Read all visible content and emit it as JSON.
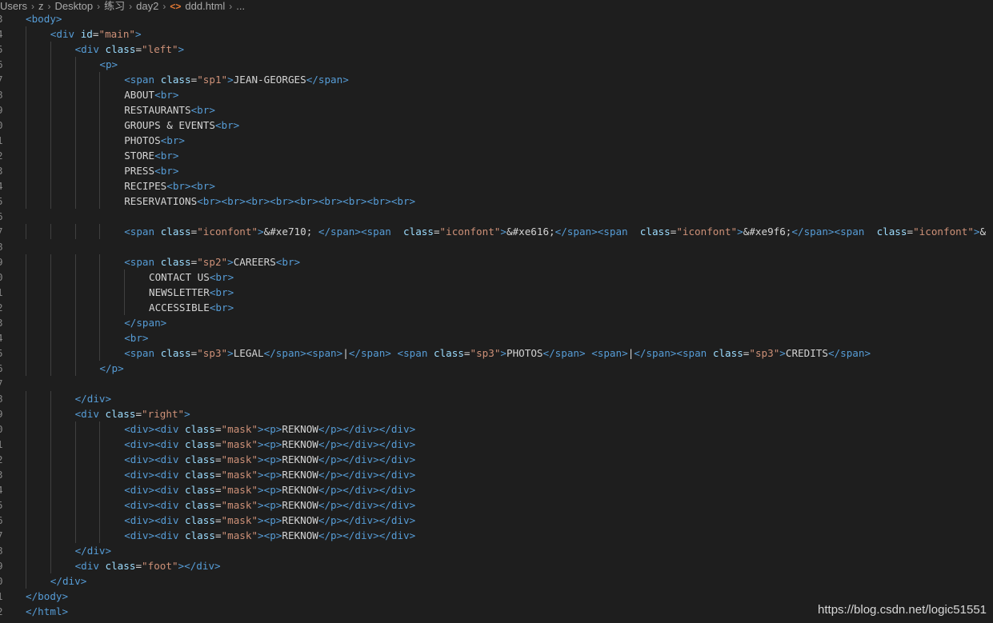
{
  "breadcrumb": {
    "parts": [
      "Users",
      "z",
      "Desktop",
      "练习",
      "day2",
      "ddd.html",
      "..."
    ],
    "file_icon": "<>"
  },
  "lines": [
    {
      "n": "3",
      "indent": 0,
      "tokens": [
        [
          "tag",
          "<body>"
        ]
      ]
    },
    {
      "n": "4",
      "indent": 1,
      "tokens": [
        [
          "tag",
          "<div "
        ],
        [
          "attr",
          "id"
        ],
        [
          "txt",
          "="
        ],
        [
          "str",
          "\"main\""
        ],
        [
          "tag",
          ">"
        ]
      ]
    },
    {
      "n": "5",
      "indent": 2,
      "tokens": [
        [
          "tag",
          "<div "
        ],
        [
          "attr",
          "class"
        ],
        [
          "txt",
          "="
        ],
        [
          "str",
          "\"left\""
        ],
        [
          "tag",
          ">"
        ]
      ]
    },
    {
      "n": "6",
      "indent": 3,
      "tokens": [
        [
          "tag",
          "<p>"
        ]
      ]
    },
    {
      "n": "7",
      "indent": 4,
      "tokens": [
        [
          "tag",
          "<span "
        ],
        [
          "attr",
          "class"
        ],
        [
          "txt",
          "="
        ],
        [
          "str",
          "\"sp1\""
        ],
        [
          "tag",
          ">"
        ],
        [
          "txt",
          "JEAN-GEORGES"
        ],
        [
          "tag",
          "</span>"
        ]
      ]
    },
    {
      "n": "8",
      "indent": 4,
      "tokens": [
        [
          "txt",
          "ABOUT"
        ],
        [
          "tag",
          "<br>"
        ]
      ]
    },
    {
      "n": "9",
      "indent": 4,
      "tokens": [
        [
          "txt",
          "RESTAURANTS"
        ],
        [
          "tag",
          "<br>"
        ]
      ]
    },
    {
      "n": "0",
      "indent": 4,
      "tokens": [
        [
          "txt",
          "GROUPS & EVENTS"
        ],
        [
          "tag",
          "<br>"
        ]
      ]
    },
    {
      "n": "1",
      "indent": 4,
      "tokens": [
        [
          "txt",
          "PHOTOS"
        ],
        [
          "tag",
          "<br>"
        ]
      ]
    },
    {
      "n": "2",
      "indent": 4,
      "tokens": [
        [
          "txt",
          "STORE"
        ],
        [
          "tag",
          "<br>"
        ]
      ]
    },
    {
      "n": "3",
      "indent": 4,
      "tokens": [
        [
          "txt",
          "PRESS"
        ],
        [
          "tag",
          "<br>"
        ]
      ]
    },
    {
      "n": "4",
      "indent": 4,
      "tokens": [
        [
          "txt",
          "RECIPES"
        ],
        [
          "tag",
          "<br><br>"
        ]
      ]
    },
    {
      "n": "5",
      "indent": 4,
      "tokens": [
        [
          "txt",
          "RESERVATIONS"
        ],
        [
          "tag",
          "<br><br><br><br><br><br><br><br><br>"
        ]
      ]
    },
    {
      "n": "6",
      "indent": 0,
      "tokens": []
    },
    {
      "n": "7",
      "indent": 4,
      "tokens": [
        [
          "tag",
          "<span "
        ],
        [
          "attr",
          "class"
        ],
        [
          "txt",
          "="
        ],
        [
          "str",
          "\"iconfont\""
        ],
        [
          "tag",
          ">"
        ],
        [
          "ent",
          "&#xe710; "
        ],
        [
          "tag",
          "</span><span  "
        ],
        [
          "attr",
          "class"
        ],
        [
          "txt",
          "="
        ],
        [
          "str",
          "\"iconfont\""
        ],
        [
          "tag",
          ">"
        ],
        [
          "ent",
          "&#xe616;"
        ],
        [
          "tag",
          "</span><span  "
        ],
        [
          "attr",
          "class"
        ],
        [
          "txt",
          "="
        ],
        [
          "str",
          "\"iconfont\""
        ],
        [
          "tag",
          ">"
        ],
        [
          "ent",
          "&#xe9f6;"
        ],
        [
          "tag",
          "</span><span  "
        ],
        [
          "attr",
          "class"
        ],
        [
          "txt",
          "="
        ],
        [
          "str",
          "\"iconfont\""
        ],
        [
          "tag",
          ">"
        ],
        [
          "ent",
          "&"
        ]
      ]
    },
    {
      "n": "8",
      "indent": 0,
      "tokens": []
    },
    {
      "n": "9",
      "indent": 4,
      "tokens": [
        [
          "tag",
          "<span "
        ],
        [
          "attr",
          "class"
        ],
        [
          "txt",
          "="
        ],
        [
          "str",
          "\"sp2\""
        ],
        [
          "tag",
          ">"
        ],
        [
          "txt",
          "CAREERS"
        ],
        [
          "tag",
          "<br>"
        ]
      ]
    },
    {
      "n": "0",
      "indent": 5,
      "tokens": [
        [
          "txt",
          "CONTACT US"
        ],
        [
          "tag",
          "<br>"
        ]
      ]
    },
    {
      "n": "1",
      "indent": 5,
      "tokens": [
        [
          "txt",
          "NEWSLETTER"
        ],
        [
          "tag",
          "<br>"
        ]
      ]
    },
    {
      "n": "2",
      "indent": 5,
      "tokens": [
        [
          "txt",
          "ACCESSIBLE"
        ],
        [
          "tag",
          "<br>"
        ]
      ]
    },
    {
      "n": "3",
      "indent": 4,
      "tokens": [
        [
          "tag",
          "</span>"
        ]
      ]
    },
    {
      "n": "4",
      "indent": 4,
      "tokens": [
        [
          "tag",
          "<br>"
        ]
      ]
    },
    {
      "n": "5",
      "indent": 4,
      "tokens": [
        [
          "tag",
          "<span "
        ],
        [
          "attr",
          "class"
        ],
        [
          "txt",
          "="
        ],
        [
          "str",
          "\"sp3\""
        ],
        [
          "tag",
          ">"
        ],
        [
          "txt",
          "LEGAL"
        ],
        [
          "tag",
          "</span><span>"
        ],
        [
          "txt",
          "|"
        ],
        [
          "tag",
          "</span>"
        ],
        [
          "txt",
          " "
        ],
        [
          "tag",
          "<span "
        ],
        [
          "attr",
          "class"
        ],
        [
          "txt",
          "="
        ],
        [
          "str",
          "\"sp3\""
        ],
        [
          "tag",
          ">"
        ],
        [
          "txt",
          "PHOTOS"
        ],
        [
          "tag",
          "</span>"
        ],
        [
          "txt",
          " "
        ],
        [
          "tag",
          "<span>"
        ],
        [
          "txt",
          "|"
        ],
        [
          "tag",
          "</span><span "
        ],
        [
          "attr",
          "class"
        ],
        [
          "txt",
          "="
        ],
        [
          "str",
          "\"sp3\""
        ],
        [
          "tag",
          ">"
        ],
        [
          "txt",
          "CREDITS"
        ],
        [
          "tag",
          "</span>"
        ]
      ]
    },
    {
      "n": "6",
      "indent": 3,
      "tokens": [
        [
          "tag",
          "</p>"
        ]
      ]
    },
    {
      "n": "7",
      "indent": 0,
      "tokens": []
    },
    {
      "n": "8",
      "indent": 2,
      "tokens": [
        [
          "tag",
          "</div>"
        ]
      ]
    },
    {
      "n": "9",
      "indent": 2,
      "tokens": [
        [
          "tag",
          "<div "
        ],
        [
          "attr",
          "class"
        ],
        [
          "txt",
          "="
        ],
        [
          "str",
          "\"right\""
        ],
        [
          "tag",
          ">"
        ]
      ]
    },
    {
      "n": "0",
      "indent": 4,
      "tokens": [
        [
          "tag",
          "<div><div "
        ],
        [
          "attr",
          "class"
        ],
        [
          "txt",
          "="
        ],
        [
          "str",
          "\"mask\""
        ],
        [
          "tag",
          "><p>"
        ],
        [
          "txt",
          "REKNOW"
        ],
        [
          "tag",
          "</p></div></div>"
        ]
      ]
    },
    {
      "n": "1",
      "indent": 4,
      "tokens": [
        [
          "tag",
          "<div><div "
        ],
        [
          "attr",
          "class"
        ],
        [
          "txt",
          "="
        ],
        [
          "str",
          "\"mask\""
        ],
        [
          "tag",
          "><p>"
        ],
        [
          "txt",
          "REKNOW"
        ],
        [
          "tag",
          "</p></div></div>"
        ]
      ]
    },
    {
      "n": "2",
      "indent": 4,
      "tokens": [
        [
          "tag",
          "<div><div "
        ],
        [
          "attr",
          "class"
        ],
        [
          "txt",
          "="
        ],
        [
          "str",
          "\"mask\""
        ],
        [
          "tag",
          "><p>"
        ],
        [
          "txt",
          "REKNOW"
        ],
        [
          "tag",
          "</p></div></div>"
        ]
      ]
    },
    {
      "n": "3",
      "indent": 4,
      "tokens": [
        [
          "tag",
          "<div><div "
        ],
        [
          "attr",
          "class"
        ],
        [
          "txt",
          "="
        ],
        [
          "str",
          "\"mask\""
        ],
        [
          "tag",
          "><p>"
        ],
        [
          "txt",
          "REKNOW"
        ],
        [
          "tag",
          "</p></div></div>"
        ]
      ]
    },
    {
      "n": "4",
      "indent": 4,
      "tokens": [
        [
          "tag",
          "<div><div "
        ],
        [
          "attr",
          "class"
        ],
        [
          "txt",
          "="
        ],
        [
          "str",
          "\"mask\""
        ],
        [
          "tag",
          "><p>"
        ],
        [
          "txt",
          "REKNOW"
        ],
        [
          "tag",
          "</p></div></div>"
        ]
      ]
    },
    {
      "n": "5",
      "indent": 4,
      "tokens": [
        [
          "tag",
          "<div><div "
        ],
        [
          "attr",
          "class"
        ],
        [
          "txt",
          "="
        ],
        [
          "str",
          "\"mask\""
        ],
        [
          "tag",
          "><p>"
        ],
        [
          "txt",
          "REKNOW"
        ],
        [
          "tag",
          "</p></div></div>"
        ]
      ]
    },
    {
      "n": "6",
      "indent": 4,
      "tokens": [
        [
          "tag",
          "<div><div "
        ],
        [
          "attr",
          "class"
        ],
        [
          "txt",
          "="
        ],
        [
          "str",
          "\"mask\""
        ],
        [
          "tag",
          "><p>"
        ],
        [
          "txt",
          "REKNOW"
        ],
        [
          "tag",
          "</p></div></div>"
        ]
      ]
    },
    {
      "n": "7",
      "indent": 4,
      "tokens": [
        [
          "tag",
          "<div><div "
        ],
        [
          "attr",
          "class"
        ],
        [
          "txt",
          "="
        ],
        [
          "str",
          "\"mask\""
        ],
        [
          "tag",
          "><p>"
        ],
        [
          "txt",
          "REKNOW"
        ],
        [
          "tag",
          "</p></div></div>"
        ]
      ]
    },
    {
      "n": "8",
      "indent": 2,
      "tokens": [
        [
          "tag",
          "</div>"
        ]
      ]
    },
    {
      "n": "9",
      "indent": 2,
      "tokens": [
        [
          "tag",
          "<div "
        ],
        [
          "attr",
          "class"
        ],
        [
          "txt",
          "="
        ],
        [
          "str",
          "\"foot\""
        ],
        [
          "tag",
          "></div>"
        ]
      ]
    },
    {
      "n": "0",
      "indent": 1,
      "tokens": [
        [
          "tag",
          "</div>"
        ]
      ]
    },
    {
      "n": "1",
      "indent": 0,
      "tokens": [
        [
          "tag",
          "</body>"
        ]
      ]
    },
    {
      "n": "2",
      "indent": 0,
      "tokens": [
        [
          "tag",
          "</html>"
        ]
      ]
    }
  ],
  "watermark": "https://blog.csdn.net/logic51551",
  "colors": {
    "background": "#1e1e1e",
    "tag": "#569cd6",
    "attribute": "#9cdcfe",
    "string": "#ce9178",
    "text": "#d4d4d4",
    "line_number": "#858585"
  }
}
